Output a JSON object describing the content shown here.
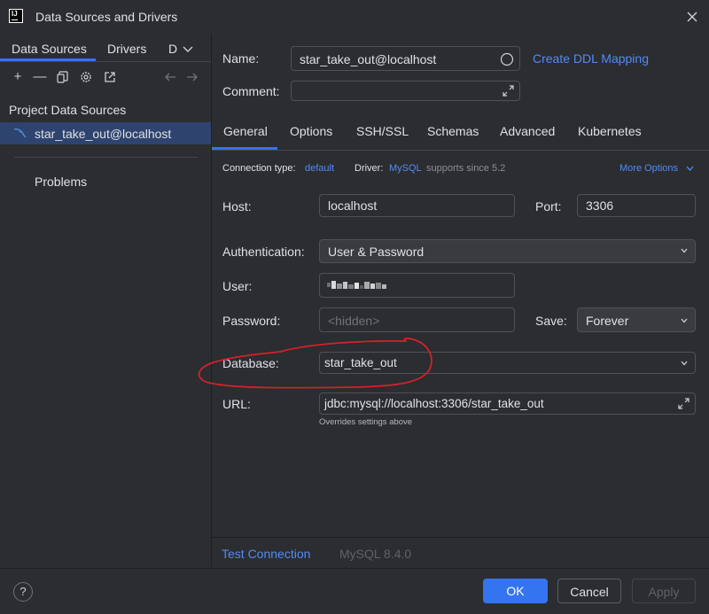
{
  "window": {
    "title": "Data Sources and Drivers"
  },
  "left": {
    "tabs": [
      "Data Sources",
      "Drivers",
      "D"
    ],
    "section_title": "Project Data Sources",
    "selected_item": "star_take_out@localhost",
    "problems_label": "Problems"
  },
  "header": {
    "name_label": "Name:",
    "name_value": "star_take_out@localhost",
    "comment_label": "Comment:",
    "comment_value": "",
    "ddl_link": "Create DDL Mapping"
  },
  "tabs": [
    "General",
    "Options",
    "SSH/SSL",
    "Schemas",
    "Advanced",
    "Kubernetes"
  ],
  "connection": {
    "type_label": "Connection type:",
    "type_value": "default",
    "driver_label": "Driver:",
    "driver_value": "MySQL",
    "driver_note": "supports since 5.2",
    "more_options": "More Options"
  },
  "form": {
    "host_label": "Host:",
    "host_value": "localhost",
    "port_label": "Port:",
    "port_value": "3306",
    "auth_label": "Authentication:",
    "auth_value": "User & Password",
    "user_label": "User:",
    "password_label": "Password:",
    "password_placeholder": "<hidden>",
    "save_label": "Save:",
    "save_value": "Forever",
    "database_label": "Database:",
    "database_value": "star_take_out",
    "url_label": "URL:",
    "url_value": "jdbc:mysql://localhost:3306/star_take_out",
    "url_note": "Overrides settings above"
  },
  "bottom": {
    "test_connection": "Test Connection",
    "server_version": "MySQL 8.4.0"
  },
  "footer": {
    "help": "?",
    "ok": "OK",
    "cancel": "Cancel",
    "apply": "Apply"
  },
  "colors": {
    "accent": "#3574f0",
    "link": "#548af7",
    "annotation": "#d3212d",
    "selection": "#2e436e"
  }
}
